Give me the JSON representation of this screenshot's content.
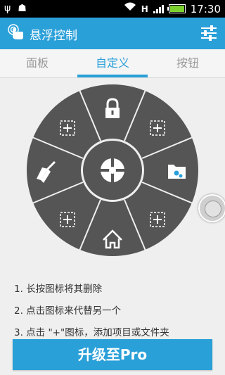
{
  "status_bar": {
    "time": "17:30",
    "network_letter": "H"
  },
  "app": {
    "title": "悬浮控制"
  },
  "tabs": [
    {
      "label": "面板",
      "active": false
    },
    {
      "label": "自定义",
      "active": true
    },
    {
      "label": "按钮",
      "active": false
    }
  ],
  "wheel": {
    "slots": [
      "lock-icon",
      "add-icon",
      "folder-settings-icon",
      "add-icon",
      "home-icon",
      "add-icon",
      "broom-icon",
      "add-icon"
    ],
    "center": "crosshair-icon"
  },
  "instructions": [
    "1. 长按图标将其删除",
    "2. 点击图标来代替另一个",
    "3. 点击 \"+\"图标，添加项目或文件夹"
  ],
  "upgrade_button": {
    "label": "升级至Pro"
  },
  "colors": {
    "accent": "#2aa0d9",
    "wheel": "#555555",
    "background": "#efefef"
  }
}
